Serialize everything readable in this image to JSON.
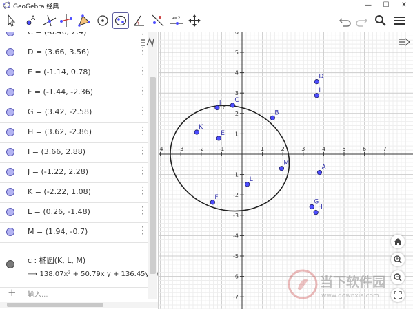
{
  "window": {
    "title": "GeoGebra 经典",
    "minimize": "—",
    "maximize": "☐",
    "close": "✕"
  },
  "toolbar": {
    "tools": [
      "move-tool",
      "point-tool",
      "perpendicular-line-tool",
      "perpendicular-bisector-tool",
      "polygon-tool",
      "circle-tool",
      "ellipse-tool",
      "angle-tool",
      "reflect-tool",
      "slider-tool",
      "move-graphics-view-tool"
    ],
    "slider_label": "a=2",
    "active_tool": "ellipse-tool"
  },
  "algebra": {
    "rows": [
      {
        "text": "C = (-0.46, 2.4)"
      },
      {
        "text": "D = (3.66, 3.56)"
      },
      {
        "text": "E = (-1.14, 0.78)"
      },
      {
        "text": "F = (-1.44, -2.36)"
      },
      {
        "text": "G = (3.42, -2.58)"
      },
      {
        "text": "H = (3.62, -2.86)"
      },
      {
        "text": "I = (3.66, 2.88)"
      },
      {
        "text": "J = (-1.22, 2.28)"
      },
      {
        "text": "K = (-2.22, 1.08)"
      },
      {
        "text": "L = (0.26, -1.48)"
      },
      {
        "text": "M = (1.94, -0.7)"
      }
    ],
    "conic_definition": "c : 椭圆(K, L, M)",
    "conic_equation": "⟶  138.07x² + 50.79x y + 136.45y² +",
    "input_placeholder": "输入..."
  },
  "graphics": {
    "x_ticks": [
      "-4",
      "-3",
      "-2",
      "-1",
      "1",
      "2",
      "3",
      "4",
      "5",
      "6",
      "7"
    ],
    "y_ticks": [
      "6",
      "5",
      "4",
      "3",
      "2",
      "1",
      "-1",
      "-2",
      "-3",
      "-4",
      "-5",
      "-6",
      "-7"
    ],
    "points": [
      {
        "label": "A",
        "x": 3.8,
        "y": -0.9
      },
      {
        "label": "B",
        "x": 1.5,
        "y": 1.78
      },
      {
        "label": "C",
        "x": -0.46,
        "y": 2.4
      },
      {
        "label": "D",
        "x": 3.66,
        "y": 3.56
      },
      {
        "label": "E",
        "x": -1.14,
        "y": 0.78
      },
      {
        "label": "F",
        "x": -1.44,
        "y": -2.36
      },
      {
        "label": "G",
        "x": 3.42,
        "y": -2.58
      },
      {
        "label": "H",
        "x": 3.62,
        "y": -2.86
      },
      {
        "label": "I",
        "x": 3.66,
        "y": 2.88
      },
      {
        "label": "J",
        "x": -1.22,
        "y": 2.28
      },
      {
        "label": "K",
        "x": -2.22,
        "y": 1.08
      },
      {
        "label": "L",
        "x": 0.26,
        "y": -1.48
      },
      {
        "label": "M",
        "x": 1.94,
        "y": -0.7
      }
    ],
    "conic_label": "c",
    "buttons": [
      "home",
      "zoom-in",
      "zoom-out",
      "fullscreen"
    ]
  },
  "watermark": {
    "line1": "当下软件园",
    "line2": "www.downxia.com"
  },
  "colors": {
    "point_fill": "#4d4dff",
    "point_stroke": "#222266",
    "axis": "#333333",
    "grid_minor": "#eeeeee",
    "grid_major": "#cccccc"
  }
}
